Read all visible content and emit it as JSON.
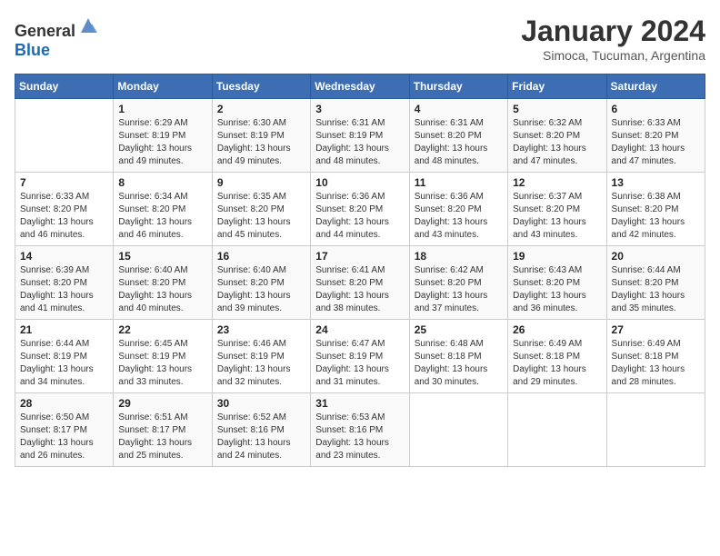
{
  "header": {
    "logo_general": "General",
    "logo_blue": "Blue",
    "month_title": "January 2024",
    "subtitle": "Simoca, Tucuman, Argentina"
  },
  "calendar": {
    "days_of_week": [
      "Sunday",
      "Monday",
      "Tuesday",
      "Wednesday",
      "Thursday",
      "Friday",
      "Saturday"
    ],
    "weeks": [
      [
        {
          "day": "",
          "info": ""
        },
        {
          "day": "1",
          "info": "Sunrise: 6:29 AM\nSunset: 8:19 PM\nDaylight: 13 hours\nand 49 minutes."
        },
        {
          "day": "2",
          "info": "Sunrise: 6:30 AM\nSunset: 8:19 PM\nDaylight: 13 hours\nand 49 minutes."
        },
        {
          "day": "3",
          "info": "Sunrise: 6:31 AM\nSunset: 8:19 PM\nDaylight: 13 hours\nand 48 minutes."
        },
        {
          "day": "4",
          "info": "Sunrise: 6:31 AM\nSunset: 8:20 PM\nDaylight: 13 hours\nand 48 minutes."
        },
        {
          "day": "5",
          "info": "Sunrise: 6:32 AM\nSunset: 8:20 PM\nDaylight: 13 hours\nand 47 minutes."
        },
        {
          "day": "6",
          "info": "Sunrise: 6:33 AM\nSunset: 8:20 PM\nDaylight: 13 hours\nand 47 minutes."
        }
      ],
      [
        {
          "day": "7",
          "info": "Sunrise: 6:33 AM\nSunset: 8:20 PM\nDaylight: 13 hours\nand 46 minutes."
        },
        {
          "day": "8",
          "info": "Sunrise: 6:34 AM\nSunset: 8:20 PM\nDaylight: 13 hours\nand 46 minutes."
        },
        {
          "day": "9",
          "info": "Sunrise: 6:35 AM\nSunset: 8:20 PM\nDaylight: 13 hours\nand 45 minutes."
        },
        {
          "day": "10",
          "info": "Sunrise: 6:36 AM\nSunset: 8:20 PM\nDaylight: 13 hours\nand 44 minutes."
        },
        {
          "day": "11",
          "info": "Sunrise: 6:36 AM\nSunset: 8:20 PM\nDaylight: 13 hours\nand 43 minutes."
        },
        {
          "day": "12",
          "info": "Sunrise: 6:37 AM\nSunset: 8:20 PM\nDaylight: 13 hours\nand 43 minutes."
        },
        {
          "day": "13",
          "info": "Sunrise: 6:38 AM\nSunset: 8:20 PM\nDaylight: 13 hours\nand 42 minutes."
        }
      ],
      [
        {
          "day": "14",
          "info": "Sunrise: 6:39 AM\nSunset: 8:20 PM\nDaylight: 13 hours\nand 41 minutes."
        },
        {
          "day": "15",
          "info": "Sunrise: 6:40 AM\nSunset: 8:20 PM\nDaylight: 13 hours\nand 40 minutes."
        },
        {
          "day": "16",
          "info": "Sunrise: 6:40 AM\nSunset: 8:20 PM\nDaylight: 13 hours\nand 39 minutes."
        },
        {
          "day": "17",
          "info": "Sunrise: 6:41 AM\nSunset: 8:20 PM\nDaylight: 13 hours\nand 38 minutes."
        },
        {
          "day": "18",
          "info": "Sunrise: 6:42 AM\nSunset: 8:20 PM\nDaylight: 13 hours\nand 37 minutes."
        },
        {
          "day": "19",
          "info": "Sunrise: 6:43 AM\nSunset: 8:20 PM\nDaylight: 13 hours\nand 36 minutes."
        },
        {
          "day": "20",
          "info": "Sunrise: 6:44 AM\nSunset: 8:20 PM\nDaylight: 13 hours\nand 35 minutes."
        }
      ],
      [
        {
          "day": "21",
          "info": "Sunrise: 6:44 AM\nSunset: 8:19 PM\nDaylight: 13 hours\nand 34 minutes."
        },
        {
          "day": "22",
          "info": "Sunrise: 6:45 AM\nSunset: 8:19 PM\nDaylight: 13 hours\nand 33 minutes."
        },
        {
          "day": "23",
          "info": "Sunrise: 6:46 AM\nSunset: 8:19 PM\nDaylight: 13 hours\nand 32 minutes."
        },
        {
          "day": "24",
          "info": "Sunrise: 6:47 AM\nSunset: 8:19 PM\nDaylight: 13 hours\nand 31 minutes."
        },
        {
          "day": "25",
          "info": "Sunrise: 6:48 AM\nSunset: 8:18 PM\nDaylight: 13 hours\nand 30 minutes."
        },
        {
          "day": "26",
          "info": "Sunrise: 6:49 AM\nSunset: 8:18 PM\nDaylight: 13 hours\nand 29 minutes."
        },
        {
          "day": "27",
          "info": "Sunrise: 6:49 AM\nSunset: 8:18 PM\nDaylight: 13 hours\nand 28 minutes."
        }
      ],
      [
        {
          "day": "28",
          "info": "Sunrise: 6:50 AM\nSunset: 8:17 PM\nDaylight: 13 hours\nand 26 minutes."
        },
        {
          "day": "29",
          "info": "Sunrise: 6:51 AM\nSunset: 8:17 PM\nDaylight: 13 hours\nand 25 minutes."
        },
        {
          "day": "30",
          "info": "Sunrise: 6:52 AM\nSunset: 8:16 PM\nDaylight: 13 hours\nand 24 minutes."
        },
        {
          "day": "31",
          "info": "Sunrise: 6:53 AM\nSunset: 8:16 PM\nDaylight: 13 hours\nand 23 minutes."
        },
        {
          "day": "",
          "info": ""
        },
        {
          "day": "",
          "info": ""
        },
        {
          "day": "",
          "info": ""
        }
      ]
    ]
  }
}
